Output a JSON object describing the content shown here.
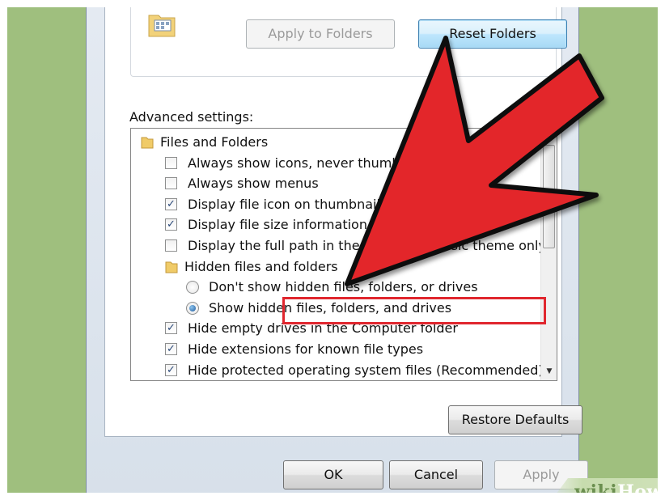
{
  "folder_views": {
    "apply_to_folders_label": "Apply to Folders",
    "reset_folders_label": "Reset Folders"
  },
  "advanced_settings": {
    "label": "Advanced settings:",
    "items": [
      {
        "type": "folder",
        "level": 0,
        "label": "Files and Folders"
      },
      {
        "type": "checkbox",
        "level": 1,
        "checked": false,
        "label": "Always show icons, never thumbnails"
      },
      {
        "type": "checkbox",
        "level": 1,
        "checked": false,
        "label": "Always show menus"
      },
      {
        "type": "checkbox",
        "level": 1,
        "checked": true,
        "label": "Display file icon on thumbnails"
      },
      {
        "type": "checkbox",
        "level": 1,
        "checked": true,
        "label": "Display file size information in folder tips"
      },
      {
        "type": "checkbox",
        "level": 1,
        "checked": false,
        "label": "Display the full path in the title bar (Classic theme only)"
      },
      {
        "type": "folder",
        "level": 1,
        "label": "Hidden files and folders"
      },
      {
        "type": "radio",
        "level": 2,
        "checked": false,
        "label": "Don't show hidden files, folders, or drives"
      },
      {
        "type": "radio",
        "level": 2,
        "checked": true,
        "label": "Show hidden files, folders, and drives"
      },
      {
        "type": "checkbox",
        "level": 1,
        "checked": true,
        "label": "Hide empty drives in the Computer folder"
      },
      {
        "type": "checkbox",
        "level": 1,
        "checked": true,
        "label": "Hide extensions for known file types"
      },
      {
        "type": "checkbox",
        "level": 1,
        "checked": true,
        "label": "Hide protected operating system files (Recommended)"
      }
    ]
  },
  "buttons": {
    "restore_defaults": "Restore Defaults",
    "ok": "OK",
    "cancel": "Cancel",
    "apply": "Apply"
  },
  "watermark": {
    "wiki": "wiki",
    "how": "How"
  },
  "colors": {
    "arrow_fill": "#e3252b",
    "highlight_border": "#e0262e",
    "frame_background": "#9fbf7e"
  },
  "icons": {
    "folder": "folder-icon",
    "arrow": "red-arrow-pointer"
  }
}
